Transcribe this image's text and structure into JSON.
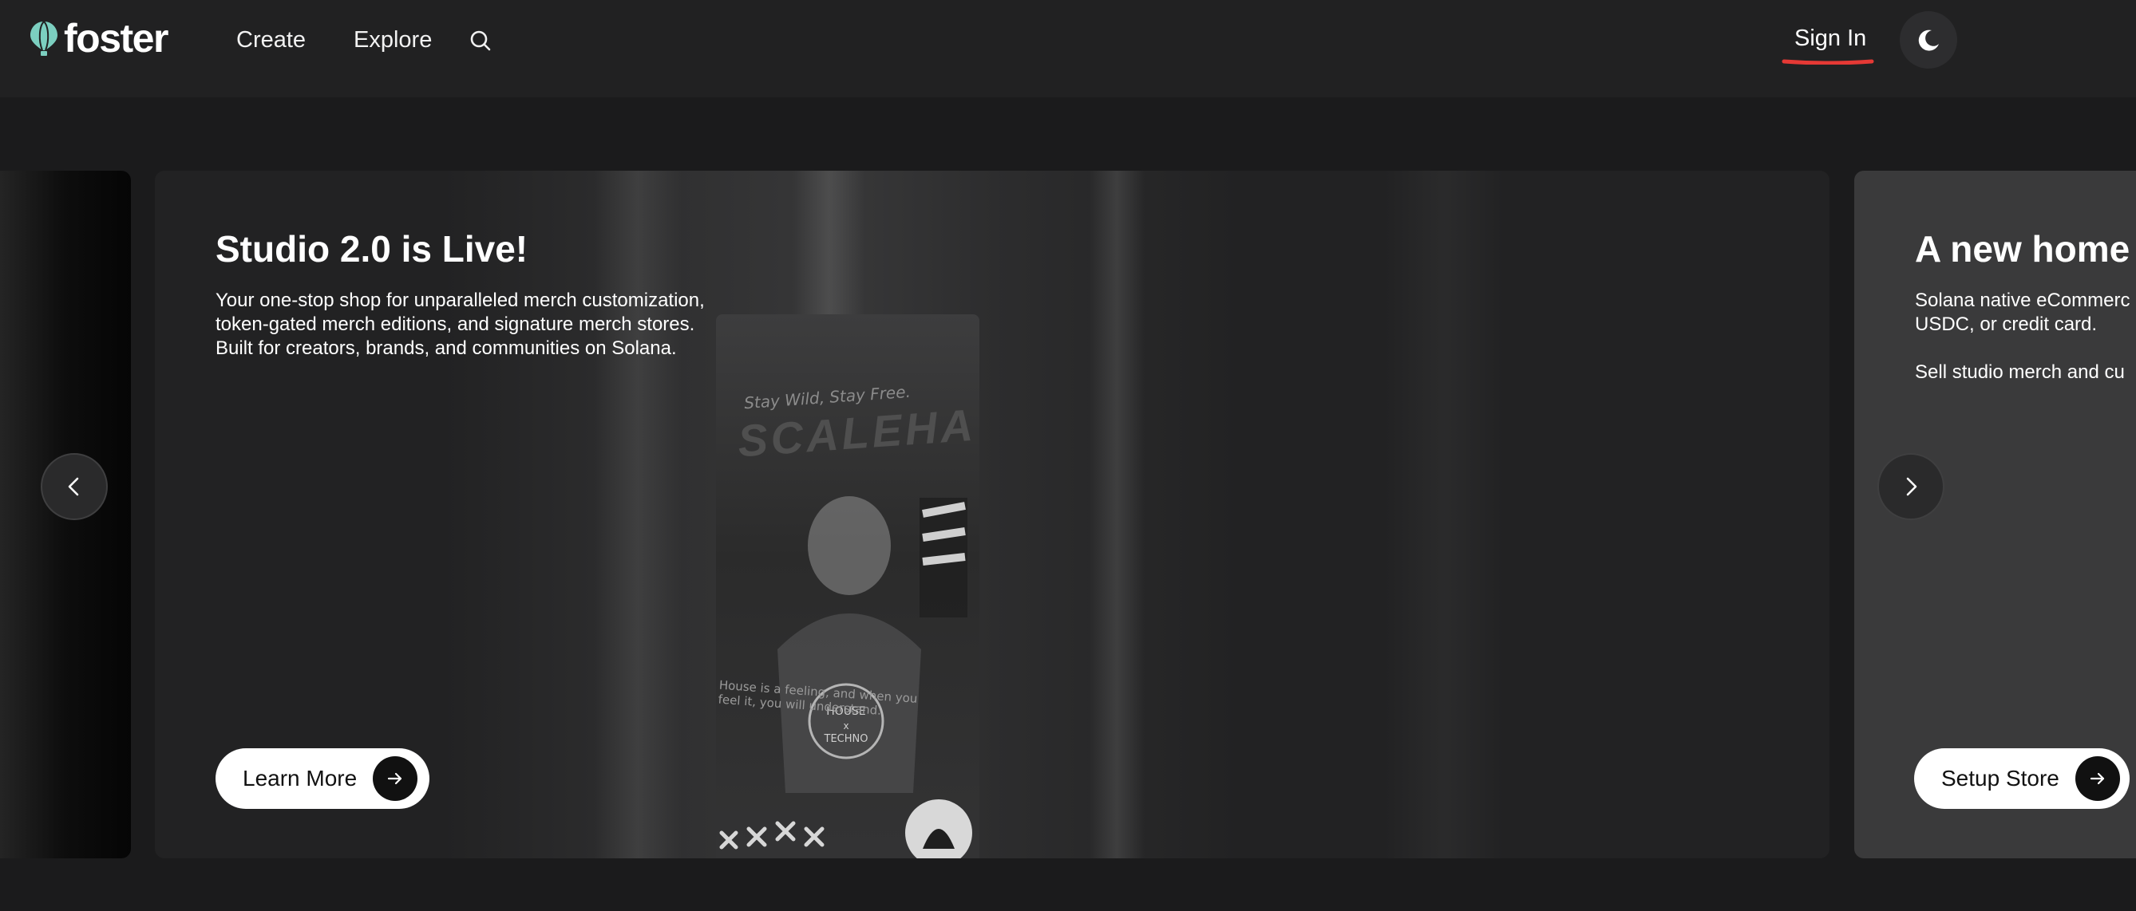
{
  "header": {
    "logo_text": "foster",
    "nav": {
      "create": "Create",
      "explore": "Explore"
    },
    "signin_label": "Sign In",
    "icons": {
      "logo": "balloon-logo-icon",
      "search": "search-icon",
      "theme": "moon-icon"
    }
  },
  "carousel": {
    "slides": [
      {
        "title": "Studio 2.0 is Live!",
        "description": [
          "Your one-stop shop for unparalleled merch customization,",
          "token-gated merch editions, and signature merch stores.",
          "Built for creators, brands, and communities on Solana."
        ],
        "button_label": "Learn More",
        "artwork_text": {
          "tagline": "Stay Wild, Stay Free.",
          "brand": "SCALEHA",
          "caption": "House is a feeling, and when you feel it, you will understand."
        }
      },
      {
        "title": "A new home",
        "description": [
          "Solana native eCommerc",
          "USDC, or credit card.",
          "",
          "Sell studio merch and cu"
        ],
        "button_label": "Setup Store"
      }
    ],
    "icons": {
      "prev": "chevron-left-icon",
      "next": "chevron-right-icon",
      "button_arrow": "arrow-right-icon"
    }
  },
  "colors": {
    "page_background": "#1b1b1c",
    "header_background": "#212122",
    "logo_accent": "#7ccfc0",
    "signin_underline": "#e53935",
    "button_background": "#ffffff"
  }
}
